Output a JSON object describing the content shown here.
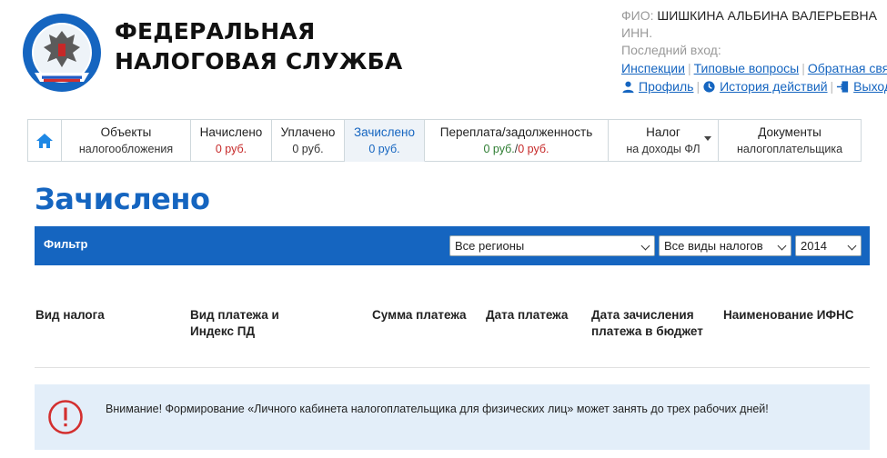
{
  "header": {
    "brand_line1": "ФЕДЕРАЛЬНАЯ",
    "brand_line2": "НАЛОГОВАЯ СЛУЖБА",
    "fio_label": "ФИО:",
    "fio_value": "ШИШКИНА АЛЬБИНА ВАЛЕРЬЕВНА",
    "inn_label": "ИНН.",
    "last_login_label": "Последний вход:",
    "links": [
      "Инспекции",
      "Типовые вопросы",
      "Обратная связь"
    ],
    "profile_label": "Профиль",
    "history_label": "История действий",
    "logout_label": "Выход"
  },
  "tabs": [
    {
      "label": "",
      "sub": "",
      "icon": "home-icon"
    },
    {
      "label": "Объекты",
      "sub": "налогообложения"
    },
    {
      "label": "Начислено",
      "sub": "0 руб."
    },
    {
      "label": "Уплачено",
      "sub": "0 руб."
    },
    {
      "label": "Зачислено",
      "sub": "0 руб."
    },
    {
      "label": "Переплата/задолженность",
      "sub_a": "0 руб.",
      "sub_sep": "/",
      "sub_b": "0 руб."
    },
    {
      "label": "Налог",
      "sub": "на доходы ФЛ"
    },
    {
      "label": "Документы",
      "sub": "налогоплательщика"
    }
  ],
  "page_title": "Зачислено",
  "filter": {
    "label": "Фильтр",
    "region": "Все регионы",
    "tax_type": "Все виды налогов",
    "year": "2014"
  },
  "table": {
    "columns": [
      "Вид налога",
      "Вид платежа и Индекс ПД",
      "Сумма платежа",
      "Дата платежа",
      "Дата зачисления платежа в бюджет",
      "Наименование ИФНС"
    ]
  },
  "alert": {
    "text": "Внимание! Формирование «Личного кабинета налогоплательщика для физических лиц» может занять до трех рабочих дней!"
  },
  "colors": {
    "accent": "#1565c0",
    "alert_bg": "#e3eef9",
    "alert_icon": "#d32f2f",
    "amount_red": "#c62828",
    "amount_green": "#2e7d32"
  }
}
